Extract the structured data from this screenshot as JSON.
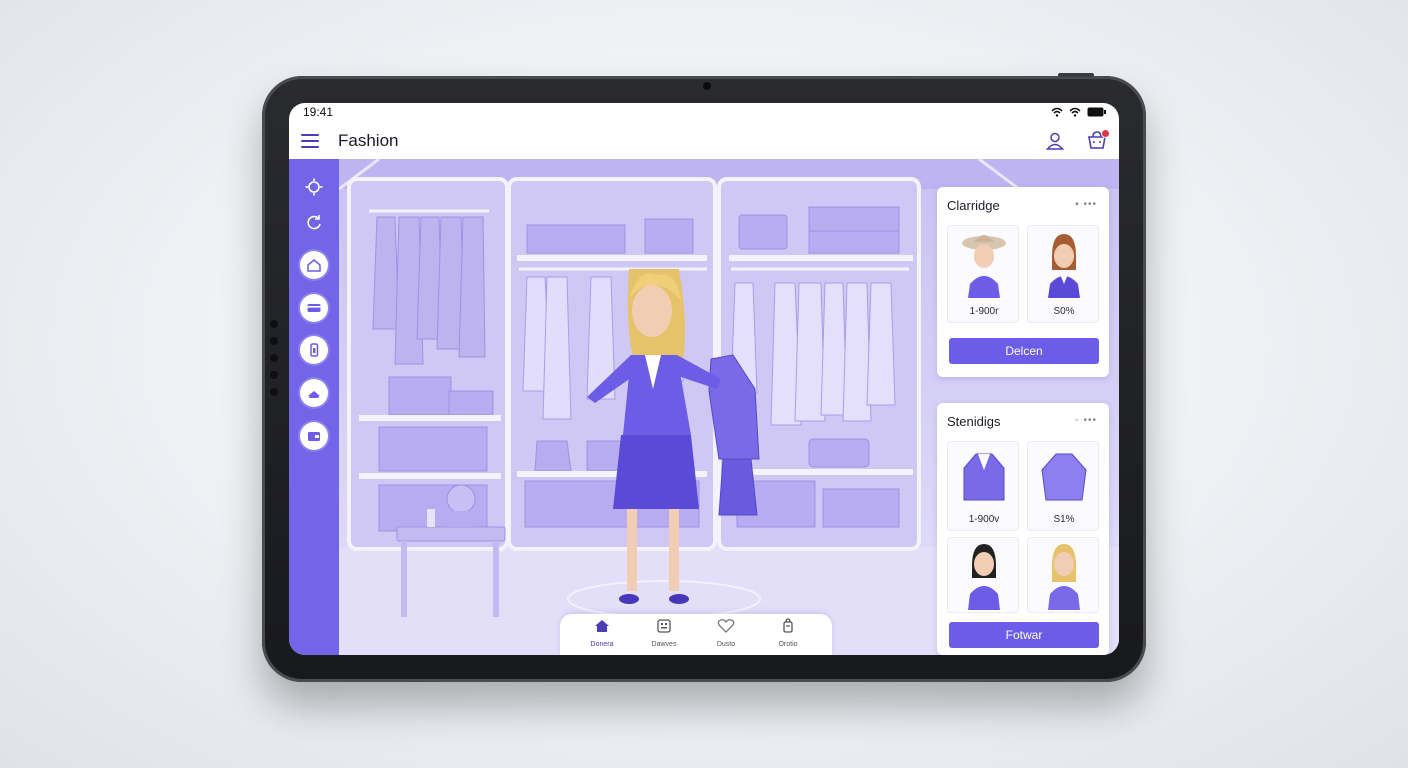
{
  "status_bar": {
    "time": "19:41"
  },
  "header": {
    "title": "Fashion"
  },
  "sidebar": {
    "items": [
      {
        "icon": "settings-icon"
      },
      {
        "icon": "refresh-icon"
      },
      {
        "icon": "home-icon"
      },
      {
        "icon": "card-icon"
      },
      {
        "icon": "phone-icon"
      },
      {
        "icon": "hanger-icon"
      },
      {
        "icon": "wallet-icon"
      }
    ]
  },
  "panel_top": {
    "title": "Clarridge",
    "cards": [
      {
        "label": "1-900r"
      },
      {
        "label": "S0%"
      }
    ],
    "button": "Delcen"
  },
  "panel_bottom": {
    "title": "Stenidigs",
    "cards": [
      {
        "label": "1-900v"
      },
      {
        "label": "S1%"
      },
      {
        "label": ""
      },
      {
        "label": ""
      }
    ],
    "button": "Fotwar"
  },
  "bottom_nav": {
    "items": [
      {
        "label": "Donera",
        "icon": "home-icon",
        "active": true
      },
      {
        "label": "Dawves",
        "icon": "grid-icon",
        "active": false
      },
      {
        "label": "Dusto",
        "icon": "heart-icon",
        "active": false
      },
      {
        "label": "Orotio",
        "icon": "bag-icon",
        "active": false
      }
    ]
  },
  "colors": {
    "accent": "#6c5ce7",
    "sidebar": "#7464e8",
    "scene": "#c9c2f3",
    "badge": "#e0364a"
  }
}
